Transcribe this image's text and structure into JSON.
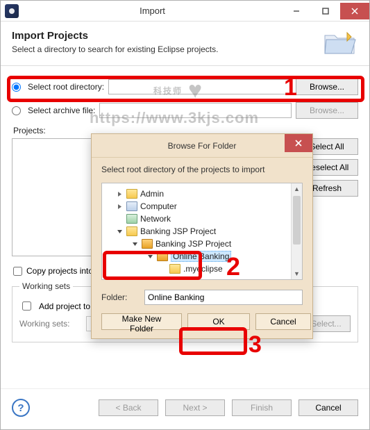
{
  "window": {
    "title": "Import"
  },
  "header": {
    "title": "Import Projects",
    "subtitle": "Select a directory to search for existing Eclipse projects."
  },
  "options": {
    "root_label": "Select root directory:",
    "archive_label": "Select archive file:",
    "browse_label": "Browse...",
    "root_selected": true
  },
  "projects": {
    "label": "Projects:",
    "select_all": "Select All",
    "deselect_all": "Deselect All",
    "refresh": "Refresh"
  },
  "copy_label": "Copy projects into workspace",
  "workingsets": {
    "legend": "Working sets",
    "add_label": "Add project to working sets",
    "row_label": "Working sets:",
    "select_btn": "Select..."
  },
  "footer": {
    "back": "< Back",
    "next": "Next >",
    "finish": "Finish",
    "cancel": "Cancel"
  },
  "modal": {
    "title": "Browse For Folder",
    "instruction": "Select root directory of the projects to import",
    "tree": [
      {
        "label": "Admin",
        "level": 1,
        "twisty": "right",
        "icon": "folderY"
      },
      {
        "label": "Computer",
        "level": 1,
        "twisty": "right",
        "icon": "comp"
      },
      {
        "label": "Network",
        "level": 1,
        "twisty": "none",
        "icon": "net"
      },
      {
        "label": "Banking JSP Project",
        "level": 1,
        "twisty": "down",
        "icon": "folderY"
      },
      {
        "label": "Banking JSP Project",
        "level": 2,
        "twisty": "down",
        "icon": "folderO"
      },
      {
        "label": "Online Banking",
        "level": 3,
        "twisty": "down",
        "icon": "folderO",
        "selected": true
      },
      {
        "label": ".myeclipse",
        "level": 4,
        "twisty": "none",
        "icon": "folderY"
      }
    ],
    "folder_label": "Folder:",
    "folder_value": "Online Banking",
    "make_new": "Make New Folder",
    "ok": "OK",
    "cancel": "Cancel"
  },
  "annotations": {
    "n1": "1",
    "n2": "2",
    "n3": "3"
  },
  "watermark": {
    "line1": "科技师",
    "line2": "https://www.3kjs.com"
  }
}
